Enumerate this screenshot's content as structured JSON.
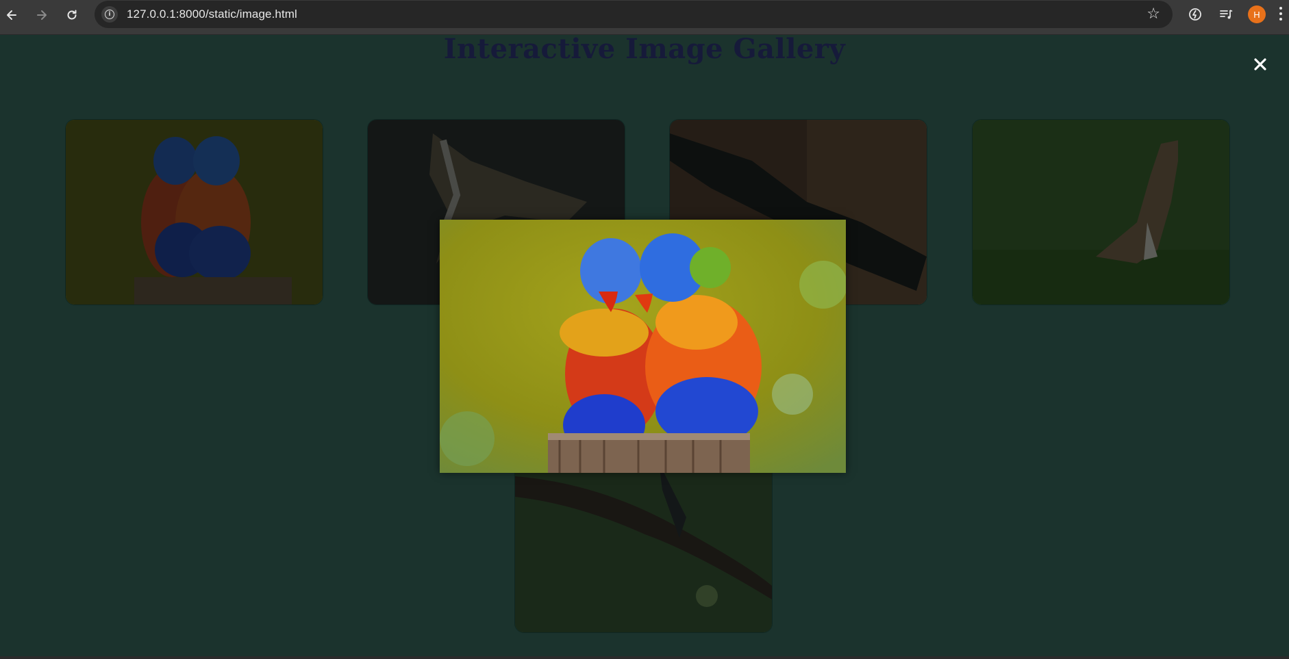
{
  "browser": {
    "url": "127.0.0.1:8000/static/image.html",
    "profile_initial": "H",
    "icons": [
      "back-arrow-icon",
      "forward-arrow-icon",
      "reload-icon",
      "site-info-icon",
      "bookmark-star-icon",
      "extension-icon",
      "media-queue-icon",
      "profile-avatar",
      "more-menu-icon"
    ]
  },
  "page": {
    "title": "Interactive Image Gallery",
    "close_symbol": "✕"
  },
  "gallery": {
    "items": [
      {
        "subject": "rainbow lorikeets on post"
      },
      {
        "subject": "hawk in flight"
      },
      {
        "subject": "bird spreading wings"
      },
      {
        "subject": "red-tailed hawk on grass"
      },
      {
        "subject": "bird on branch"
      }
    ]
  },
  "lightbox": {
    "open": true,
    "subject": "rainbow lorikeets on post"
  },
  "colors": {
    "background": "#1b332d",
    "title": "#161a3a",
    "close": "#ffffff"
  }
}
